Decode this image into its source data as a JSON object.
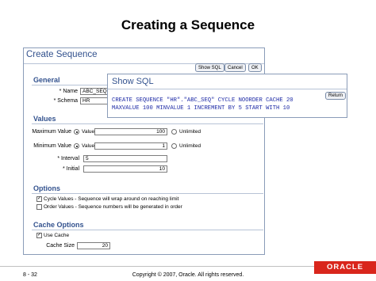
{
  "slide": {
    "title": "Creating a Sequence",
    "page_number": "8 - 32",
    "copyright": "Copyright © 2007, Oracle. All rights reserved.",
    "logo_text": "ORACLE"
  },
  "window": {
    "title": "Create Sequence",
    "buttons": {
      "show_sql": "Show SQL",
      "cancel": "Cancel",
      "ok": "OK"
    }
  },
  "general": {
    "heading": "General",
    "name_label": "* Name",
    "name_value": "ABC_SEQ",
    "schema_label": "* Schema",
    "schema_value": "HR"
  },
  "values": {
    "heading": "Values",
    "max_label": "Maximum Value",
    "max_value_option": "Value",
    "max_value": "100",
    "max_unlimited": "Unlimited",
    "min_label": "Minimum Value",
    "min_value_option": "Value",
    "min_value": "1",
    "min_unlimited": "Unlimited",
    "interval_label": "* Interval",
    "interval_value": "5",
    "initial_label": "* Initial",
    "initial_value": "10"
  },
  "options": {
    "heading": "Options",
    "cycle_label": "Cycle Values - Sequence will wrap around on reaching limit",
    "cycle_checked": true,
    "order_label": "Order Values - Sequence numbers will be generated in order",
    "order_checked": false
  },
  "cache": {
    "heading": "Cache Options",
    "use_cache_label": "Use Cache",
    "use_cache_checked": true,
    "cache_size_label": "Cache Size",
    "cache_size_value": "20"
  },
  "show_sql": {
    "title": "Show SQL",
    "return_button": "Return",
    "line1": "CREATE SEQUENCE \"HR\".\"ABC_SEQ\" CYCLE NOORDER CACHE 20",
    "line2": "MAXVALUE 100 MINVALUE 1 INCREMENT BY 5 START WITH 10"
  },
  "colors": {
    "heading_blue": "#33528e",
    "sql_blue": "#1d2aa6",
    "oracle_red": "#d9261c"
  }
}
